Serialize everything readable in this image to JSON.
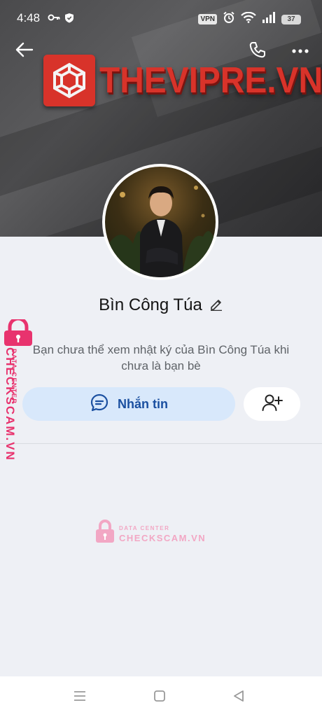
{
  "status_bar": {
    "time": "4:48",
    "vpn": "VPN",
    "battery": "37",
    "icons": [
      "key-icon",
      "shield-icon",
      "alarm-icon",
      "wifi-icon",
      "signal-icon"
    ]
  },
  "cover": {
    "logo_text": "THEVIPRE.VN",
    "logo_color": "#d8332a"
  },
  "nav": {
    "back_icon": "arrow-left-icon",
    "call_icon": "phone-icon",
    "more_icon": "more-horizontal-icon"
  },
  "profile": {
    "name": "Bìn Công Túa",
    "edit_icon": "pencil-icon",
    "notice": "Bạn chưa thể xem nhật ký của Bìn Công Túa khi chưa là bạn bè"
  },
  "actions": {
    "message_label": "Nhắn tin",
    "message_icon": "chat-bubble-icon",
    "add_friend_icon": "add-user-icon",
    "accent": "#1a4fa0"
  },
  "watermark": {
    "small": "DATA CENTER",
    "big": "CHECKSCAM.VN",
    "color": "#f2a7c4"
  },
  "system_nav": [
    "menu-icon",
    "home-icon",
    "back-triangle-icon"
  ]
}
